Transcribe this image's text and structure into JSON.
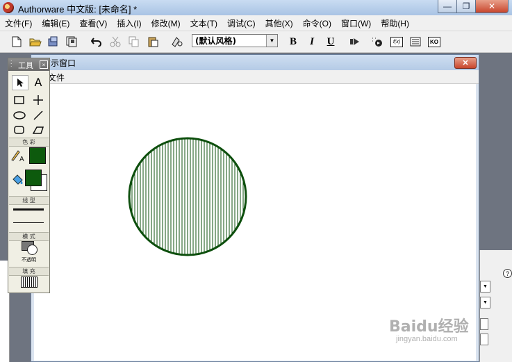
{
  "window": {
    "title": "Authorware 中文版: [未命名] *"
  },
  "menubar": {
    "items": [
      "文件(F)",
      "编辑(E)",
      "查看(V)",
      "插入(I)",
      "修改(M)",
      "文本(T)",
      "调试(C)",
      "其他(X)",
      "命令(O)",
      "窗口(W)",
      "帮助(H)"
    ]
  },
  "toolbar": {
    "style_value": "(默认风格)",
    "bold_label": "B",
    "italic_label": "I",
    "underline_label": "U",
    "fx_label": "f(x)",
    "ko_label": "KO"
  },
  "presentation": {
    "title": "演示窗口",
    "menu_file": "文件",
    "shape": "circle",
    "fill_pattern": "vertical-lines",
    "color_stroke": "#0d4f0d"
  },
  "tools": {
    "title": "工具",
    "section_color": "色 彩",
    "section_line": "线 型",
    "section_mode": "模 式",
    "mode_label": "不透明",
    "section_fill": "填 充",
    "fill_color": "#0d5a0d",
    "text_tool_glyph": "A"
  },
  "watermark": {
    "main": "Baidu经验",
    "sub": "jingyan.baidu.com"
  }
}
